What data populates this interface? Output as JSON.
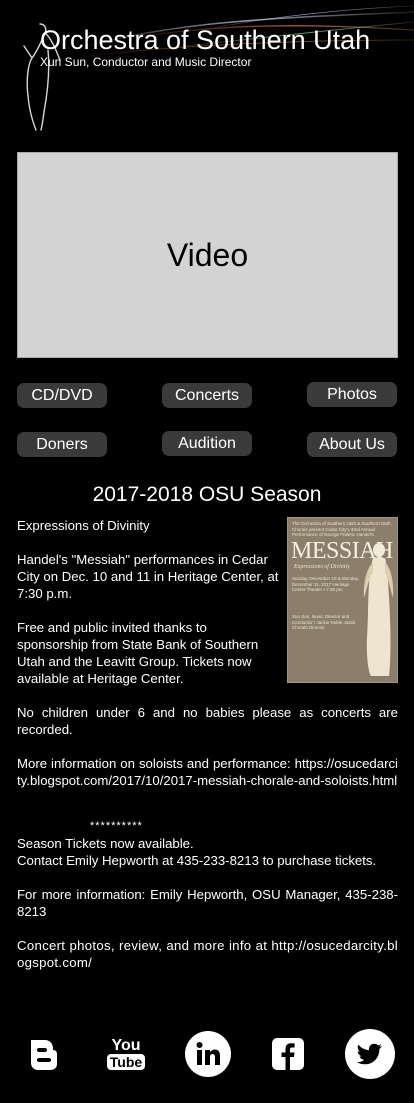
{
  "header": {
    "title": "Orchestra of Southern Utah",
    "subtitle": "Xun Sun, Conductor and Music Director"
  },
  "video": {
    "label": "Video"
  },
  "nav": {
    "cd_dvd": "CD/DVD",
    "concerts": "Concerts",
    "photos": "Photos",
    "doners": "Doners",
    "audition": "Audition",
    "about_us": "About Us"
  },
  "season": {
    "title": "2017-2018 OSU Season",
    "intro": "Expressions of Divinity",
    "performances": "Handel's \"Messiah\" performances in Cedar City on Dec. 10 and 11 in Heritage Center, at 7:30 p.m.",
    "sponsorship": "Free and public invited thanks to sponsorship from State Bank of Southern Utah and the Leavitt Group. Tickets now available at Heritage Center.",
    "children": "No children under 6 and no babies please as concerts are recorded.",
    "more_info": "More information on soloists and performance: https://osucedarcity.blogspot.com/2017/10/2017-messiah-chorale-and-soloists.html",
    "stars": "**********",
    "season_tickets": "Season Tickets now available.",
    "contact": "Contact Emily Hepworth at 435-233-8213 to purchase tickets.",
    "manager": "For more information: Emily Hepworth, OSU Manager, 435-238-8213",
    "photos_info": "Concert photos, review, and more info at http://osucedarcity.blogspot.com/"
  },
  "poster": {
    "top_text": "The Orchestra of Southern Utah & Southern Utah Chorale present Cedar City's 33rd Annual Performance of George Frideric Handel's",
    "title": "MESSIAH",
    "subtitle": "Expressions of Divinity",
    "dates": "Sunday, December 10 & Monday, December 11, 2017 Heritage Center Theater • 7:30 pm",
    "credits": "Xun Sun, Music Director and Conductor / Jackie Noble Justin, Chorale Director"
  },
  "social": {
    "icons": [
      "blogger-icon",
      "youtube-icon",
      "linkedin-icon",
      "facebook-icon",
      "twitter-icon"
    ],
    "youtube_you": "You",
    "youtube_tube": "Tube"
  },
  "colors": {
    "background": "#000000",
    "button": "#3a3a3a",
    "video_placeholder": "#d3d3d3",
    "poster": "#8b7e6a"
  }
}
